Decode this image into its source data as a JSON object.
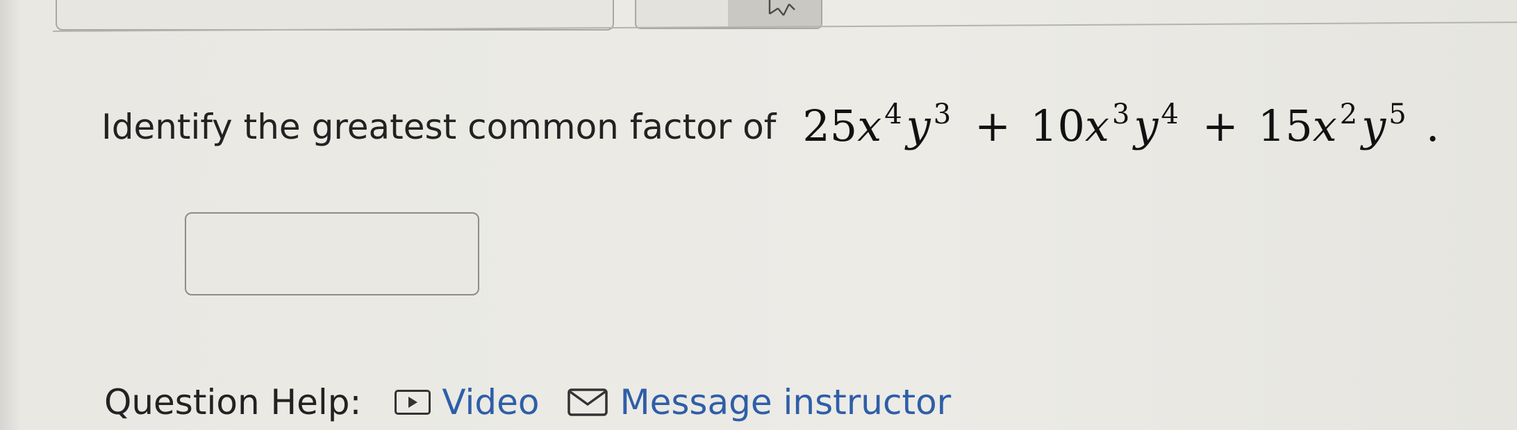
{
  "question": {
    "prompt": "Identify the greatest common factor of",
    "expression": {
      "terms": [
        {
          "coef": "25",
          "x_exp": "4",
          "y_exp": "3"
        },
        {
          "coef": "10",
          "x_exp": "3",
          "y_exp": "4"
        },
        {
          "coef": "15",
          "x_exp": "2",
          "y_exp": "5"
        }
      ],
      "operator": "+",
      "var_x": "x",
      "var_y": "y",
      "end": "."
    }
  },
  "answer": {
    "value": "",
    "placeholder": ""
  },
  "help": {
    "label": "Question Help:",
    "video_label": "Video",
    "video_icon": "video-play-icon",
    "message_label": "Message instructor",
    "message_icon": "envelope-icon"
  },
  "colors": {
    "link": "#2e5ea8",
    "text": "#222222",
    "background": "#ecebe6",
    "border": "#8d8c88"
  }
}
